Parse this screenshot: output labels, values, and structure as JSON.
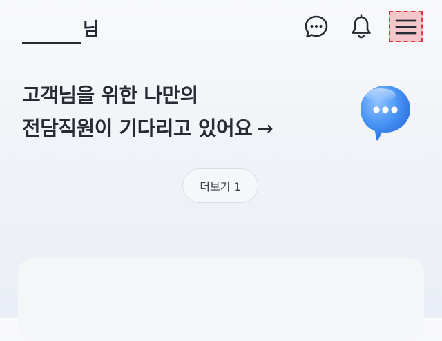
{
  "header": {
    "greeting_suffix": "님",
    "chat_icon": "chat-bubble-icon",
    "bell_icon": "bell-icon",
    "menu_icon": "hamburger-menu-icon"
  },
  "main": {
    "headline_line1": "고객님을 위한 나만의",
    "headline_line2": "전담직원이 기다리고 있어요",
    "headline_arrow": "→",
    "bubble_icon": "chat-bubble-3d-icon",
    "more_button": "더보기 1"
  },
  "colors": {
    "text": "#262a33",
    "bubble_blue": "#3d8bf2",
    "menu_highlight": "#e0353d"
  }
}
